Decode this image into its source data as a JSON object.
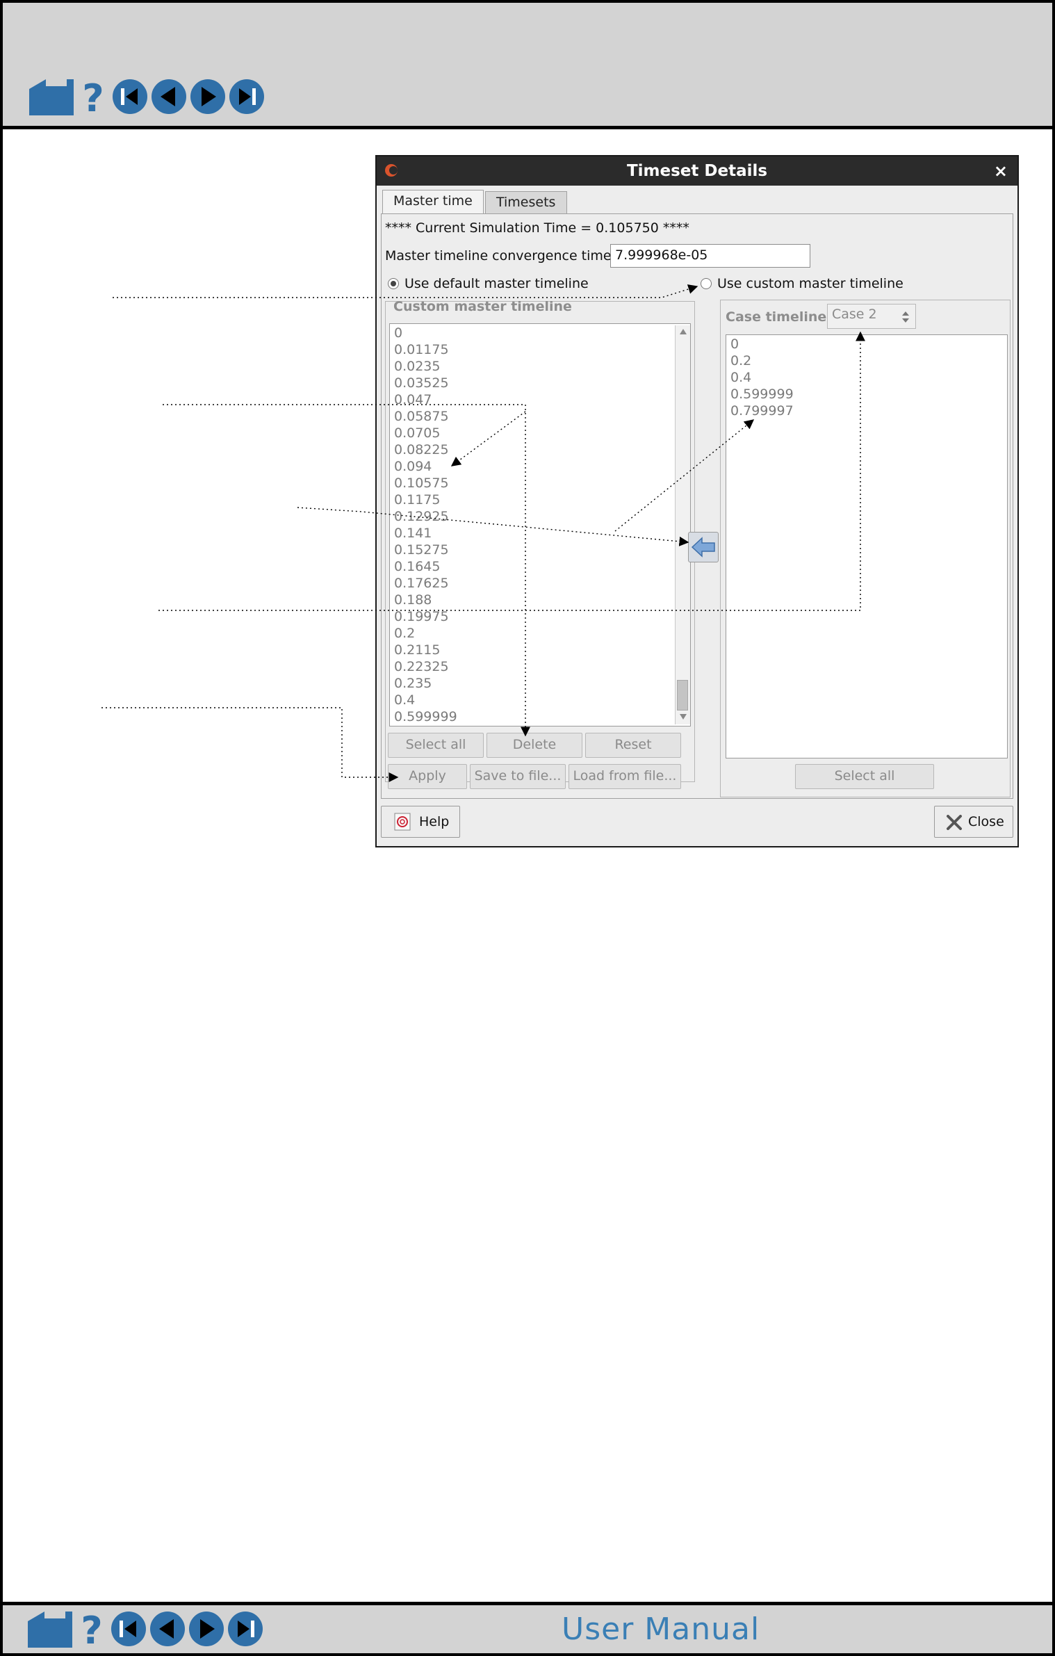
{
  "colors": {
    "nav_blue": "#2f6fa8",
    "brand_blue": "#3a7fb5",
    "titlebar": "#2b2b2b"
  },
  "nav": {
    "icons": [
      "home-icon",
      "help-icon",
      "first-page-icon",
      "previous-page-icon",
      "next-page-icon",
      "last-page-icon"
    ],
    "help_glyph": "?"
  },
  "footer": {
    "brand": "User Manual"
  },
  "dialog": {
    "title": "Timeset Details",
    "close_glyph": "×",
    "tabs": [
      {
        "label": "Master time",
        "active": true
      },
      {
        "label": "Timesets",
        "active": false
      }
    ],
    "current_time": "**** Current Simulation Time = 0.105750 ****",
    "convergence_label": "Master timeline convergence time",
    "convergence_value": "7.999968e-05",
    "radio_default": "Use default master timeline",
    "radio_custom": "Use custom master timeline",
    "custom_group_title": "Custom master timeline",
    "custom_values": [
      "0",
      "0.01175",
      "0.0235",
      "0.03525",
      "0.047",
      "0.05875",
      "0.0705",
      "0.08225",
      "0.094",
      "0.10575",
      "0.1175",
      "0.12925",
      "0.141",
      "0.15275",
      "0.1645",
      "0.17625",
      "0.188",
      "0.19975",
      "0.2",
      "0.2115",
      "0.22325",
      "0.235",
      "0.4",
      "0.599999"
    ],
    "custom_buttons": {
      "select_all": "Select all",
      "delete": "Delete",
      "reset": "Reset",
      "apply": "Apply",
      "save": "Save to file...",
      "load": "Load from file..."
    },
    "case_timeline_label": "Case timeline",
    "case_selected": "Case 2",
    "case_values": [
      "0",
      "0.2",
      "0.4",
      "0.599999",
      "0.799997"
    ],
    "case_select_all": "Select all",
    "help": "Help",
    "close": "Close"
  }
}
